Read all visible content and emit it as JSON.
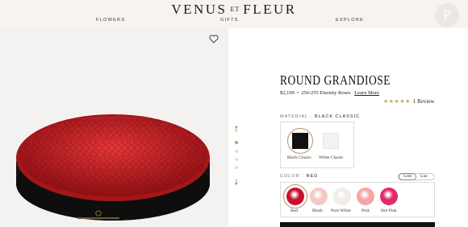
{
  "header": {
    "logo_left": "VENUS",
    "logo_mid": "ET",
    "logo_right": "FLEUR",
    "nav": [
      "FLOWERS",
      "GIFTS",
      "EXPLORE"
    ],
    "badge": "P"
  },
  "product": {
    "title": "ROUND GRANDIOSE",
    "price": "$2,199",
    "separator": "•",
    "description": "250-255 Eternity Roses",
    "learn_more": "Learn More",
    "stars": "★★★★★",
    "reviews": "1 Review"
  },
  "material": {
    "label": "MATERIAL :",
    "value": "BLACK CLASSIC",
    "options": [
      "Black Classic",
      "White Classic"
    ],
    "selected": "Black Classic"
  },
  "color": {
    "label": "COLOR :",
    "value": "RED",
    "view_toggle": [
      "Grid",
      "List"
    ],
    "options": [
      {
        "name": "Red",
        "color": "#c8102e"
      },
      {
        "name": "Blush",
        "color": "#f3c9c2"
      },
      {
        "name": "Pure White",
        "color": "#f1ede8"
      },
      {
        "name": "Pink",
        "color": "#f3a7a4"
      },
      {
        "name": "Hot Pink",
        "color": "#e02a6a"
      }
    ],
    "selected": "Red"
  },
  "gallery": {
    "slides": 4,
    "active_slide": 1
  },
  "colors": {
    "header_bg": "#f7f3ef",
    "accent_gold": "#c8a25a",
    "rose_red": "#c41e24",
    "box_black": "#111111"
  }
}
